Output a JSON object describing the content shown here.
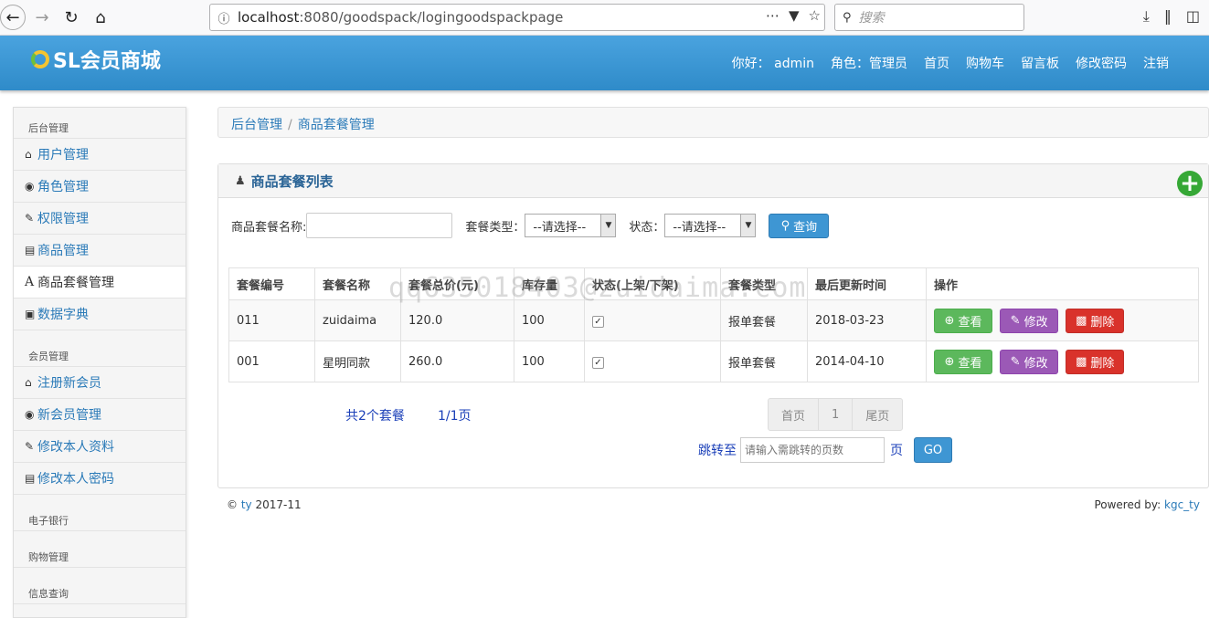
{
  "browser": {
    "url_host": "localhost",
    "url_rest": ":8080/goodspack/logingoodspackpage",
    "search_placeholder": "搜索"
  },
  "app": {
    "logo_text": "SL会员商城",
    "nav": {
      "greeting": "你好： admin",
      "role": "角色：管理员",
      "home": "首页",
      "cart": "购物车",
      "board": "留言板",
      "change_pwd": "修改密码",
      "logout": "注销"
    }
  },
  "sidebar": {
    "section1": "后台管理",
    "items1": [
      {
        "label": "用户管理",
        "icon": "home-icon"
      },
      {
        "label": "角色管理",
        "icon": "eye-icon"
      },
      {
        "label": "权限管理",
        "icon": "edit-icon"
      },
      {
        "label": "商品管理",
        "icon": "list-icon"
      },
      {
        "label": "商品套餐管理",
        "icon": "font-icon"
      },
      {
        "label": "数据字典",
        "icon": "picture-icon"
      }
    ],
    "section2": "会员管理",
    "items2": [
      {
        "label": "注册新会员",
        "icon": "home-icon"
      },
      {
        "label": "新会员管理",
        "icon": "eye-icon"
      },
      {
        "label": "修改本人资料",
        "icon": "edit-icon"
      },
      {
        "label": "修改本人密码",
        "icon": "list-icon"
      }
    ],
    "section3": "电子银行",
    "section4": "购物管理",
    "section5": "信息查询"
  },
  "breadcrumb": {
    "root": "后台管理",
    "current": "商品套餐管理"
  },
  "panel": {
    "title": "商品套餐列表",
    "filter": {
      "name_label": "商品套餐名称:",
      "type_label": "套餐类型：",
      "type_value": "--请选择--",
      "status_label": "状态：",
      "status_value": "--请选择--",
      "query_label": "查询"
    },
    "columns": [
      "套餐编号",
      "套餐名称",
      "套餐总价(元)",
      "库存量",
      "状态(上架/下架)",
      "套餐类型",
      "最后更新时间",
      "操作"
    ],
    "rows": [
      {
        "id": "011",
        "name": "zuidaima",
        "price": "120.0",
        "stock": "100",
        "status_checked": true,
        "type": "报单套餐",
        "updated": "2018-03-23"
      },
      {
        "id": "001",
        "name": "星明同款",
        "price": "260.0",
        "stock": "100",
        "status_checked": true,
        "type": "报单套餐",
        "updated": "2014-04-10"
      }
    ],
    "actions": {
      "view": "查看",
      "edit": "修改",
      "delete": "删除"
    },
    "total": "共2个套餐",
    "pages": "1/1页",
    "pager": {
      "first": "首页",
      "current": "1",
      "last": "尾页"
    },
    "jump": {
      "label": "跳转至",
      "placeholder": "请输入需跳转的页数",
      "unit": "页",
      "go": "GO"
    }
  },
  "footer": {
    "copyright_prefix": "©",
    "author": "ty",
    "year": "2017-11",
    "powered_prefix": "Powered by:",
    "powered_link": "kgc_ty"
  },
  "watermark": "qq635018403@zuidaima.com"
}
